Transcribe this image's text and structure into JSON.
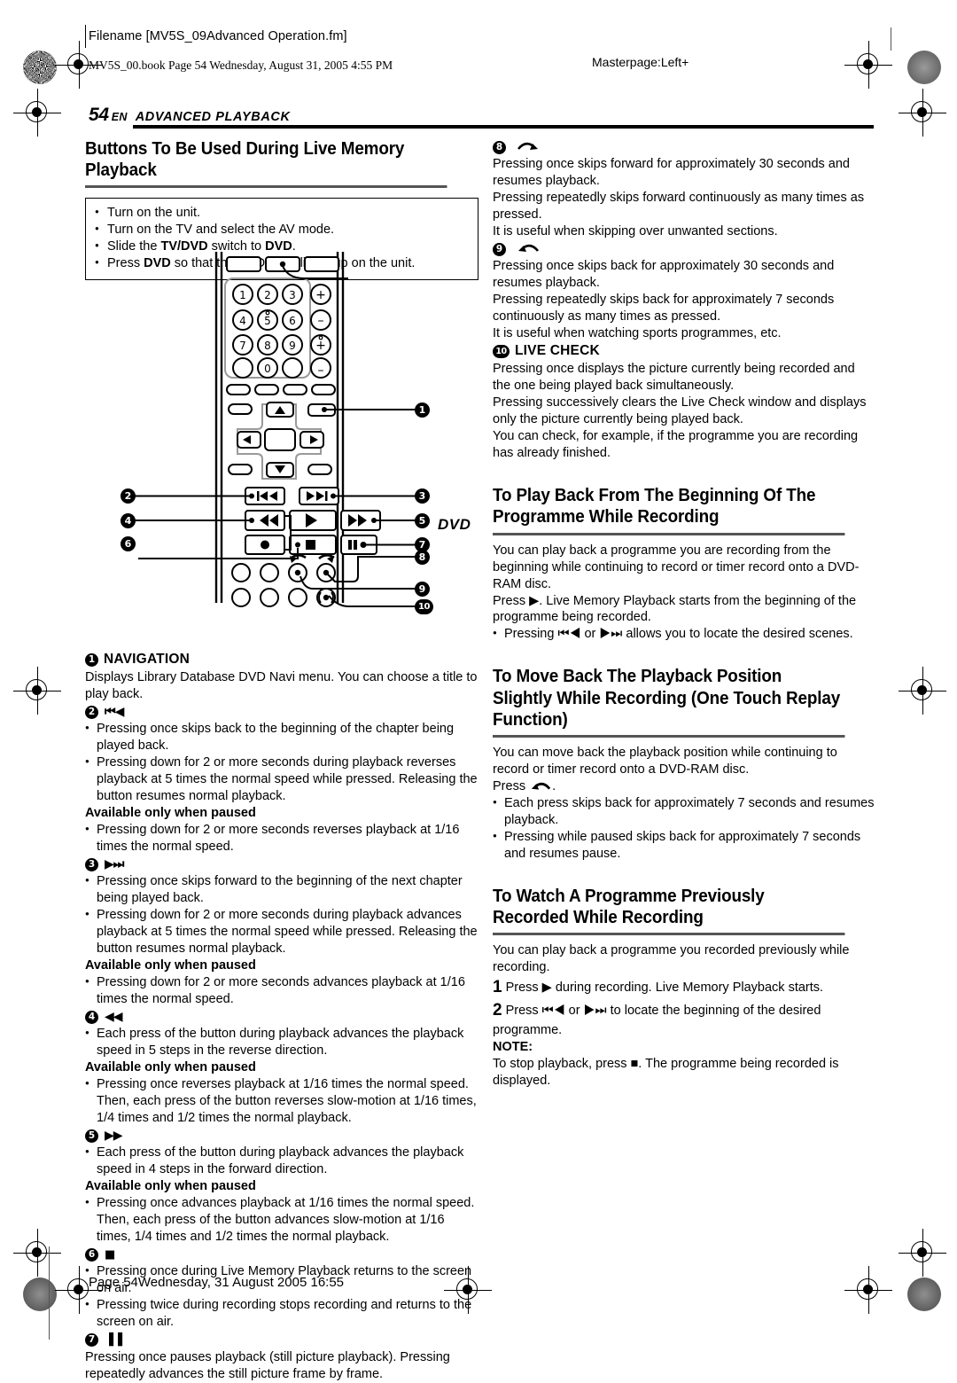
{
  "printer_marks": {
    "filename_slug": "Filename [MV5S_09Advanced Operation.fm]",
    "book_slug": "MV5S_00.book  Page 54  Wednesday, August 31, 2005  4:55 PM",
    "masterpage": "Masterpage:Left+"
  },
  "running_head": {
    "page_number": "54",
    "lang": "EN",
    "section": "ADVANCED PLAYBACK"
  },
  "left_column": {
    "heading": "Buttons To Be Used During Live Memory Playback",
    "prep_box": [
      "Turn on the unit.",
      "Turn on the TV and select the AV mode.",
      "Slide the TV/DVD switch to DVD.",
      "Press DVD so that the DVD lamp lights up on the unit."
    ],
    "remote": {
      "dvd_label": "DVD",
      "keypad": [
        "1",
        "2",
        "3",
        "4",
        "5",
        "6",
        "7",
        "8",
        "9",
        "0"
      ],
      "volume_plus": "+",
      "volume_minus": "−",
      "channel_plus": "+",
      "channel_minus": "−",
      "callouts": [
        "1",
        "2",
        "3",
        "4",
        "5",
        "6",
        "7",
        "8",
        "9",
        "10"
      ]
    },
    "items": [
      {
        "num": "1",
        "label": "NAVIGATION",
        "icon": "",
        "paras": [
          "Displays Library Database DVD Navi menu. You can choose a title to play back."
        ],
        "bullets": [],
        "paused_subhead": "",
        "paused_bullets": []
      },
      {
        "num": "2",
        "label": "",
        "icon": "⏮◀",
        "paras": [],
        "bullets": [
          "Pressing once skips back to the beginning of the chapter being played back.",
          "Pressing down for 2 or more seconds during playback reverses playback at 5 times the normal speed while pressed. Releasing the button resumes normal playback."
        ],
        "paused_subhead": "Available only when paused",
        "paused_bullets": [
          "Pressing down for 2 or more seconds reverses playback at 1/16 times the normal speed."
        ]
      },
      {
        "num": "3",
        "label": "",
        "icon": "▶⏭",
        "paras": [],
        "bullets": [
          "Pressing once skips forward to the beginning of the next chapter being played back.",
          "Pressing down for 2 or more seconds during playback advances playback at 5 times the normal speed while pressed. Releasing the button resumes normal playback."
        ],
        "paused_subhead": "Available only when paused",
        "paused_bullets": [
          "Pressing down for 2 or more seconds advances playback at 1/16 times the normal speed."
        ]
      },
      {
        "num": "4",
        "label": "",
        "icon": "◀◀",
        "paras": [],
        "bullets": [
          "Each press of the button during playback advances the playback speed in 5 steps in the reverse direction."
        ],
        "paused_subhead": "Available only when paused",
        "paused_bullets": [
          "Pressing once reverses playback at 1/16 times the normal speed. Then, each press of the button reverses slow-motion at 1/16 times, 1/4 times and 1/2 times the normal playback."
        ]
      },
      {
        "num": "5",
        "label": "",
        "icon": "▶▶",
        "paras": [],
        "bullets": [
          "Each press of the button during playback advances the playback speed in 4 steps in the forward direction."
        ],
        "paused_subhead": "Available only when paused",
        "paused_bullets": [
          "Pressing once advances playback at 1/16 times the normal speed. Then, each press of the button advances slow-motion at 1/16 times, 1/4 times and 1/2 times the normal playback."
        ]
      },
      {
        "num": "6",
        "label": "",
        "icon": "■",
        "paras": [],
        "bullets": [
          "Pressing once during Live Memory Playback returns to the screen on air.",
          "Pressing twice during recording stops recording and returns to the screen on air."
        ],
        "paused_subhead": "",
        "paused_bullets": []
      },
      {
        "num": "7",
        "label": "",
        "icon": "▐▐",
        "paras": [
          "Pressing once pauses playback (still picture playback). Pressing repeatedly advances the still picture frame by frame."
        ],
        "bullets": [],
        "paused_subhead": "",
        "paused_bullets": []
      }
    ]
  },
  "right_column": {
    "items": [
      {
        "num": "8",
        "label": "",
        "icon": "skip-forward-arc-icon",
        "paras": [
          "Pressing once skips forward for approximately 30 seconds and resumes playback.",
          "Pressing repeatedly skips forward continuously as many times as pressed.",
          "It is useful when skipping over unwanted sections."
        ]
      },
      {
        "num": "9",
        "label": "",
        "icon": "skip-back-arc-icon",
        "paras": [
          "Pressing once skips back for approximately 30 seconds and resumes playback.",
          "Pressing repeatedly skips back for approximately 7 seconds continuously as many times as pressed.",
          "It is useful when watching sports programmes, etc."
        ]
      },
      {
        "num": "10",
        "label": "LIVE CHECK",
        "icon": "",
        "paras": [
          "Pressing once displays the picture currently being recorded and the one being played back simultaneously.",
          "Pressing successively clears the Live Check window and displays only the picture currently being played back.",
          "You can check, for example, if the programme you are recording has already finished."
        ]
      }
    ],
    "section_play_back": {
      "heading": "To Play Back From The Beginning Of The Programme While Recording",
      "paras": [
        "You can play back a programme you are recording from the beginning while continuing to record or timer record onto a DVD-RAM disc.",
        "Press ▶. Live Memory Playback starts from the beginning of the programme being recorded."
      ],
      "bullets": [
        "Pressing ⏮◀ or ▶⏭ allows you to locate the desired scenes."
      ]
    },
    "section_move_back": {
      "heading": "To Move Back The Playback Position Slightly While Recording (One Touch Replay Function)",
      "paras": [
        "You can move back the playback position while continuing to record or timer record onto a DVD-RAM disc.",
        "Press"
      ],
      "press_suffix": ".",
      "bullets": [
        "Each press skips back for approximately 7 seconds and resumes playback.",
        "Pressing while paused skips back for approximately 7 seconds and resumes pause."
      ]
    },
    "section_watch": {
      "heading": "To Watch A Programme Previously Recorded While Recording",
      "intro": "You can play back a programme you recorded previously while recording.",
      "steps": [
        {
          "n": "1",
          "text": "Press ▶ during recording. Live Memory Playback starts."
        },
        {
          "n": "2",
          "text": "Press ⏮◀ or ▶⏭ to locate the beginning of the desired programme."
        }
      ],
      "note_label": "NOTE:",
      "note_text": "To stop playback, press ■. The programme being recorded is displayed."
    }
  },
  "footer": {
    "text": "Page 54Wednesday, 31 August 2005  16:55"
  }
}
